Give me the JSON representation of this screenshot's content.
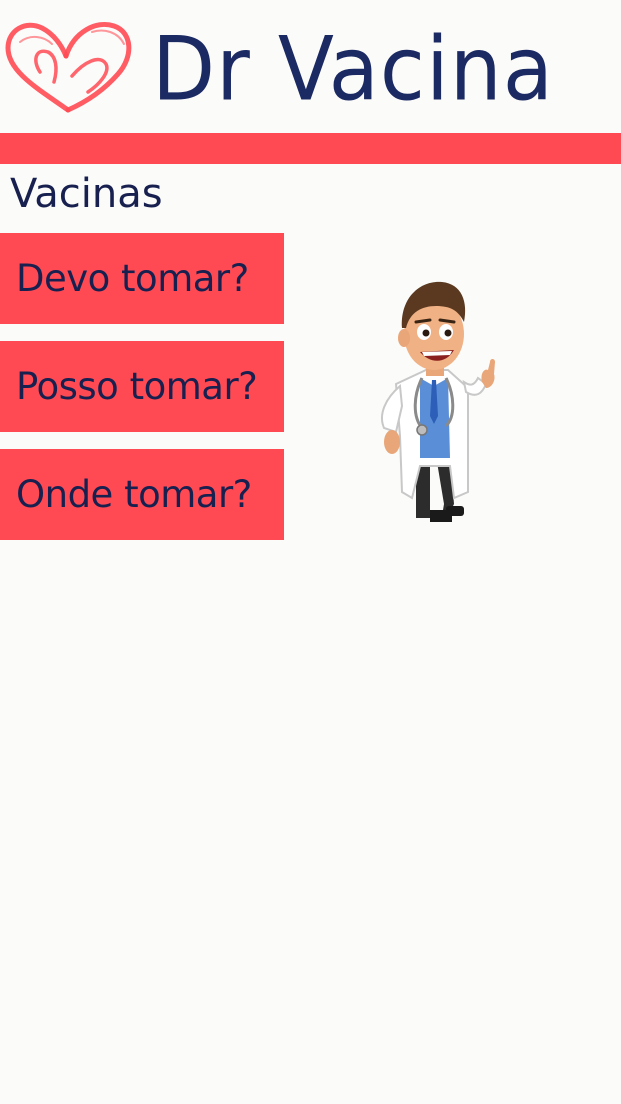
{
  "brand": {
    "name": "Dr Vacina",
    "logo_icon": "heart-logo-icon"
  },
  "colors": {
    "accent": "#ff4a53",
    "text_dark": "#18204f",
    "brand_text": "#1b2a63",
    "background": "#fbfbf9"
  },
  "section": {
    "title": "Vacinas"
  },
  "menu": {
    "items": [
      {
        "label": "Devo tomar?"
      },
      {
        "label": "Posso tomar?"
      },
      {
        "label": "Onde tomar?"
      }
    ]
  },
  "illustration": {
    "icon": "doctor-illustration-icon"
  }
}
